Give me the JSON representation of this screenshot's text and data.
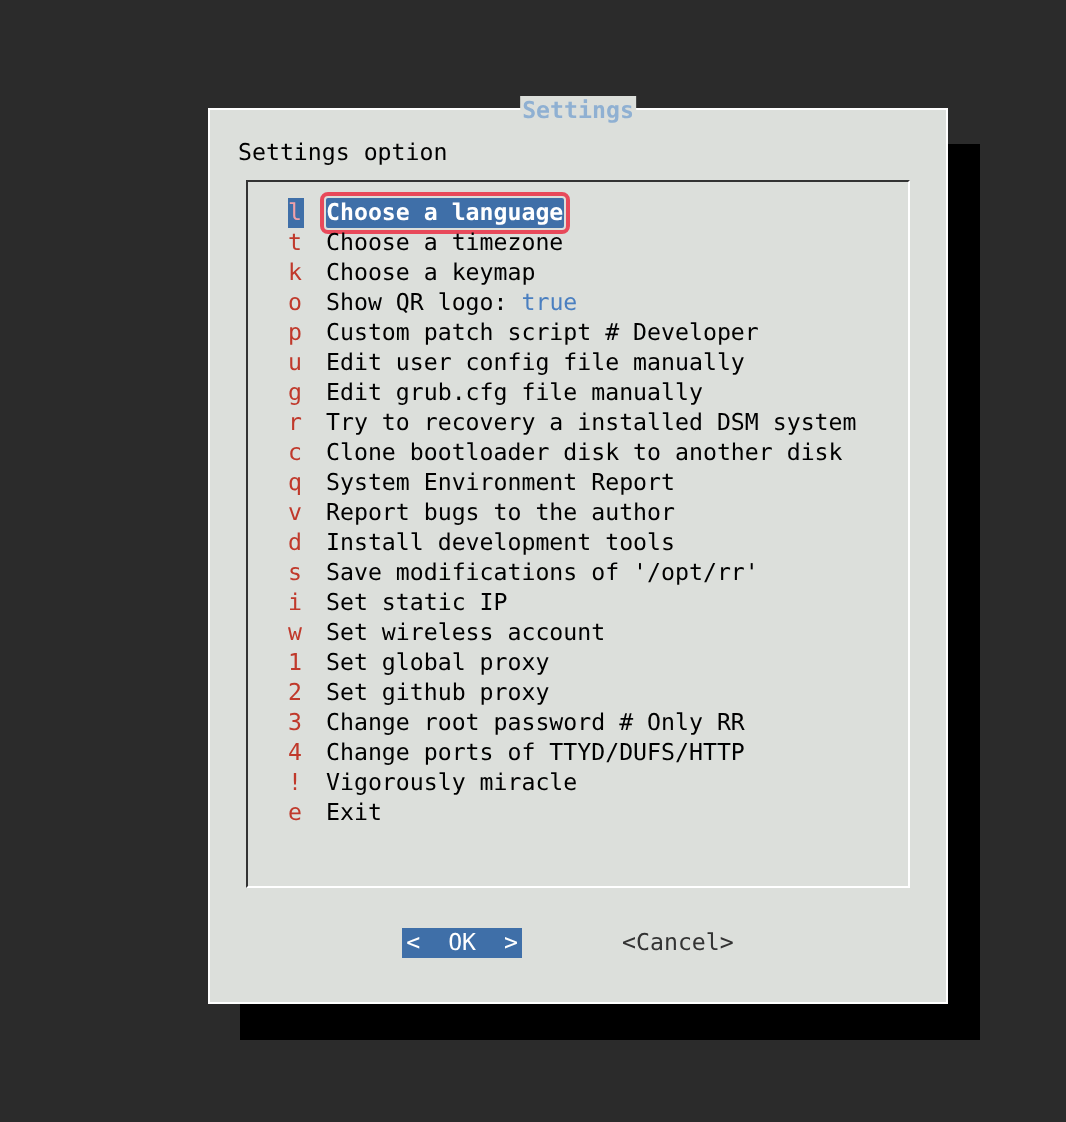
{
  "dialog": {
    "title": "Settings",
    "prompt": "Settings option",
    "items": [
      {
        "key": "l",
        "label": "Choose a language",
        "selected": true
      },
      {
        "key": "t",
        "label": "Choose a timezone",
        "selected": false
      },
      {
        "key": "k",
        "label": "Choose a keymap",
        "selected": false
      },
      {
        "key": "o",
        "label": "Show QR logo:",
        "value": "true",
        "selected": false
      },
      {
        "key": "p",
        "label": "Custom patch script # Developer",
        "selected": false
      },
      {
        "key": "u",
        "label": "Edit user config file manually",
        "selected": false
      },
      {
        "key": "g",
        "label": "Edit grub.cfg file manually",
        "selected": false
      },
      {
        "key": "r",
        "label": "Try to recovery a installed DSM system",
        "selected": false
      },
      {
        "key": "c",
        "label": "Clone bootloader disk to another disk",
        "selected": false
      },
      {
        "key": "q",
        "label": "System Environment Report",
        "selected": false
      },
      {
        "key": "v",
        "label": "Report bugs to the author",
        "selected": false
      },
      {
        "key": "d",
        "label": "Install development tools",
        "selected": false
      },
      {
        "key": "s",
        "label": "Save modifications of '/opt/rr'",
        "selected": false
      },
      {
        "key": "i",
        "label": "Set static IP",
        "selected": false
      },
      {
        "key": "w",
        "label": "Set wireless account",
        "selected": false
      },
      {
        "key": "1",
        "label": "Set global proxy",
        "selected": false
      },
      {
        "key": "2",
        "label": "Set github proxy",
        "selected": false
      },
      {
        "key": "3",
        "label": "Change root password # Only RR",
        "selected": false
      },
      {
        "key": "4",
        "label": "Change ports of TTYD/DUFS/HTTP",
        "selected": false
      },
      {
        "key": "!",
        "label": "Vigorously miracle",
        "selected": false
      },
      {
        "key": "e",
        "label": "Exit",
        "selected": false
      }
    ],
    "buttons": [
      {
        "open": "<",
        "label": "OK",
        "close": ">",
        "selected": true
      },
      {
        "open": "<",
        "label": "Cancel",
        "close": ">",
        "selected": false
      }
    ]
  }
}
